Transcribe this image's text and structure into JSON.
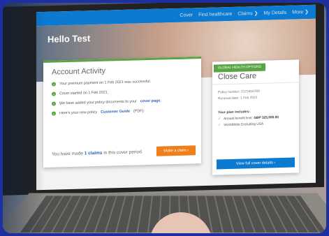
{
  "nav": {
    "items": [
      "Cover",
      "Find healthcare",
      "Claims ❯",
      "My Details",
      "More ❯"
    ]
  },
  "hero": {
    "greeting": "Hello Test"
  },
  "activity": {
    "title": "Account Activity",
    "items": [
      {
        "text": "Your premium payment on 1 Feb 2021 was successful."
      },
      {
        "text": "Cover started on 1 Feb 2021."
      },
      {
        "text": "We have added your policy documents to your",
        "link": "cover page."
      },
      {
        "text": "Here's your new policy",
        "link": "Customer Guide",
        "suffix": "(PDF)."
      }
    ],
    "claims_prefix": "You have made",
    "claims_count": "1 claims",
    "claims_suffix": "in this cover period.",
    "make_claim": "Make a claim  ›"
  },
  "care": {
    "badge": "GLOBAL HEALTH OPTIONS",
    "title": "Close Care",
    "policy_number": "Policy number: 0123456789",
    "renewal_date": "Renewal date: 1 Feb 2022",
    "includes_label": "Your plan includes:",
    "benefit_label": "Annual benefit limit:",
    "benefit_value": "GBP 325,000.00",
    "coverage": "WorldWide Excluding USA",
    "view_cover": "View full cover details  ›"
  },
  "colors": {
    "nav_blue": "#0c7ad0",
    "green": "#59a546",
    "orange": "#ef7f1a"
  }
}
